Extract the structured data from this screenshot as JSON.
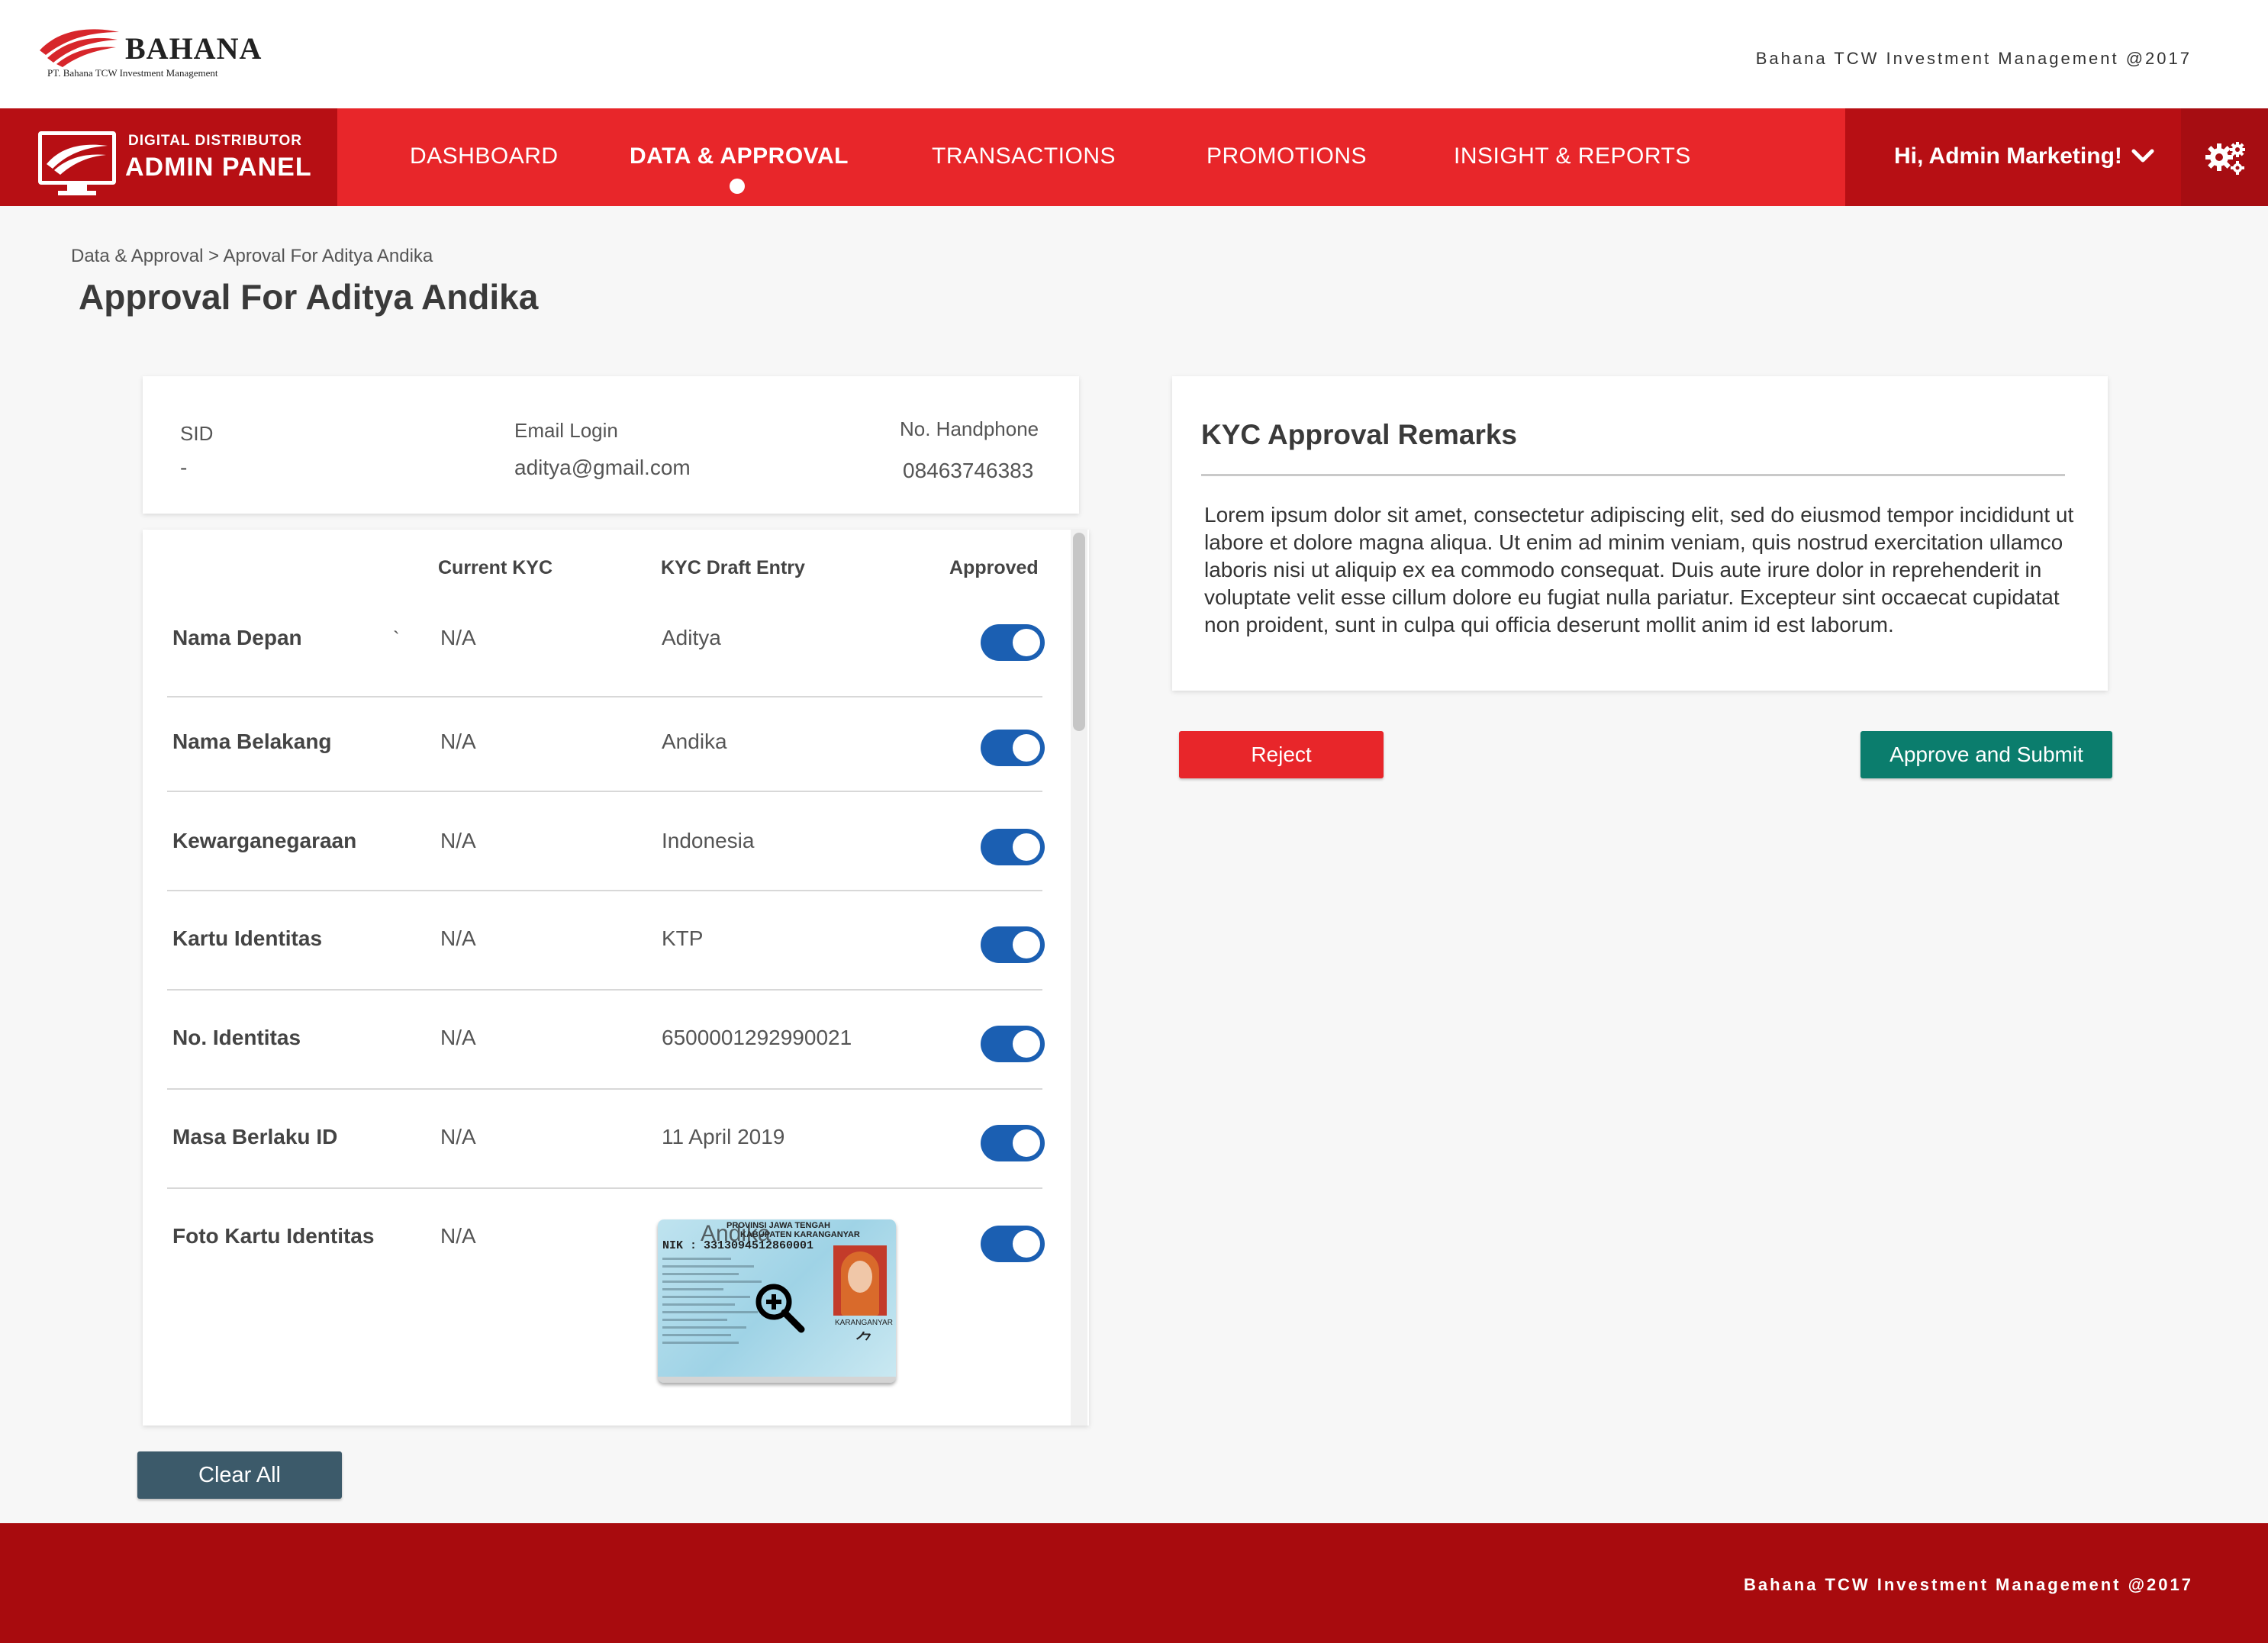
{
  "header": {
    "logo_word": "BAHANA",
    "logo_subtitle": "PT. Bahana TCW Investment Management",
    "copyright": "Bahana TCW Investment Management @2017"
  },
  "nav": {
    "brand_small": "DIGITAL DISTRIBUTOR",
    "brand_big": "ADMIN PANEL",
    "items": [
      {
        "label": "DASHBOARD",
        "active": false
      },
      {
        "label": "DATA & APPROVAL",
        "active": true
      },
      {
        "label": "TRANSACTIONS",
        "active": false
      },
      {
        "label": "PROMOTIONS",
        "active": false
      },
      {
        "label": "INSIGHT & REPORTS",
        "active": false
      }
    ],
    "user_label": "Hi, Admin Marketing!",
    "user_icon": "chevron-down-icon",
    "settings_icon": "gear-icon",
    "colors": {
      "bar": "#e8262a",
      "dark": "#b70f14"
    }
  },
  "page": {
    "breadcrumb": "Data & Approval > Aproval For Aditya Andika",
    "title": "Approval For Aditya Andika"
  },
  "info": {
    "sid_label": "SID",
    "sid_value": "-",
    "email_label": "Email Login",
    "email_value": "aditya@gmail.com",
    "phone_label": "No. Handphone",
    "phone_value": "08463746383"
  },
  "kyc_table": {
    "columns": [
      "Current KYC",
      "KYC Draft Entry",
      "Approved"
    ],
    "stray_mark": "`",
    "rows": [
      {
        "label": "Nama Depan",
        "current": "N/A",
        "draft": "Aditya",
        "approved": true
      },
      {
        "label": "Nama Belakang",
        "current": "N/A",
        "draft": "Andika",
        "approved": true
      },
      {
        "label": "Kewarganegaraan",
        "current": "N/A",
        "draft": "Indonesia",
        "approved": true
      },
      {
        "label": "Kartu Identitas",
        "current": "N/A",
        "draft": "KTP",
        "approved": true
      },
      {
        "label": "No. Identitas",
        "current": "N/A",
        "draft": "6500001292990021",
        "approved": true
      },
      {
        "label": "Masa Berlaku ID",
        "current": "N/A",
        "draft": "11 April 2019",
        "approved": true
      },
      {
        "label": "Foto Kartu Identitas",
        "current": "N/A",
        "draft": "",
        "approved": true
      }
    ],
    "id_card": {
      "province": "PROVINSI JAWA TENGAH",
      "regency": "KABUPATEN KARANGANYAR",
      "overlay_name": "Andika",
      "nik": "NIK  : 3313094512860001",
      "place": "KARANGANYAR",
      "zoom_icon": "zoom-in-icon"
    },
    "toggle_color": "#1b5fb2",
    "clear_label": "Clear All"
  },
  "remarks": {
    "title": "KYC Approval Remarks",
    "body": "Lorem ipsum dolor sit amet, consectetur adipiscing elit, sed do eiusmod tempor incididunt ut labore et dolore magna aliqua. Ut enim ad minim veniam, quis nostrud exercitation ullamco laboris nisi ut aliquip ex ea commodo consequat. Duis aute irure dolor in reprehenderit in voluptate velit esse cillum dolore eu fugiat nulla pariatur. Excepteur sint occaecat cupidatat non proident, sunt in culpa qui officia deserunt mollit anim id est laborum.",
    "reject_label": "Reject",
    "approve_label": "Approve and Submit",
    "reject_color": "#e8262a",
    "approve_color": "#0b7d6d"
  },
  "footer": {
    "copyright": "Bahana TCW Investment Management @2017"
  }
}
